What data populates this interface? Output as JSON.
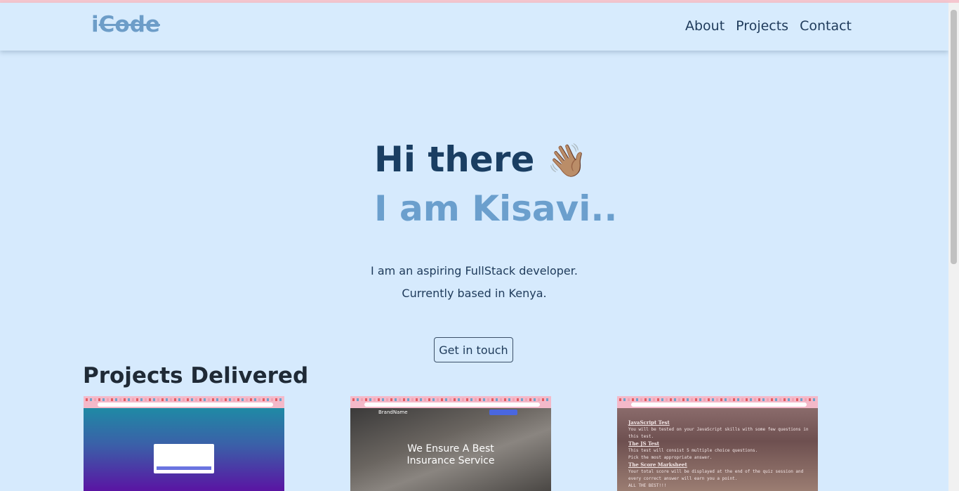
{
  "navbar": {
    "logo": {
      "first": "i",
      "rest": "Code"
    },
    "links": [
      "About",
      "Projects",
      "Contact"
    ]
  },
  "hero": {
    "greeting": "Hi there",
    "wave": "👋🏽",
    "name": "I am Kisavi..",
    "tagline_1": "I am an aspiring FullStack developer.",
    "tagline_2": "Currently based in Kenya.",
    "cta_label": "Get in touch"
  },
  "projects": {
    "title": "Projects Delivered",
    "card2": {
      "brand": "BrandName",
      "headline_1": "We Ensure A Best",
      "headline_2": "Insurance Service"
    },
    "card3": {
      "title": "JavaScript Test",
      "line1": "You will be tested on your JavaScript skills with some few questions in this test.",
      "h2": "The JS Test",
      "line2": "This test will consist 5 multiple choice questions.",
      "line3": "Pick the most appropriate answer.",
      "h3": "The Score Marksheet",
      "line4": "Your total score will be displayed at the end of the quiz session and every correct answer will earn you a point.",
      "line5": "ALL THE BEST!!!"
    }
  }
}
